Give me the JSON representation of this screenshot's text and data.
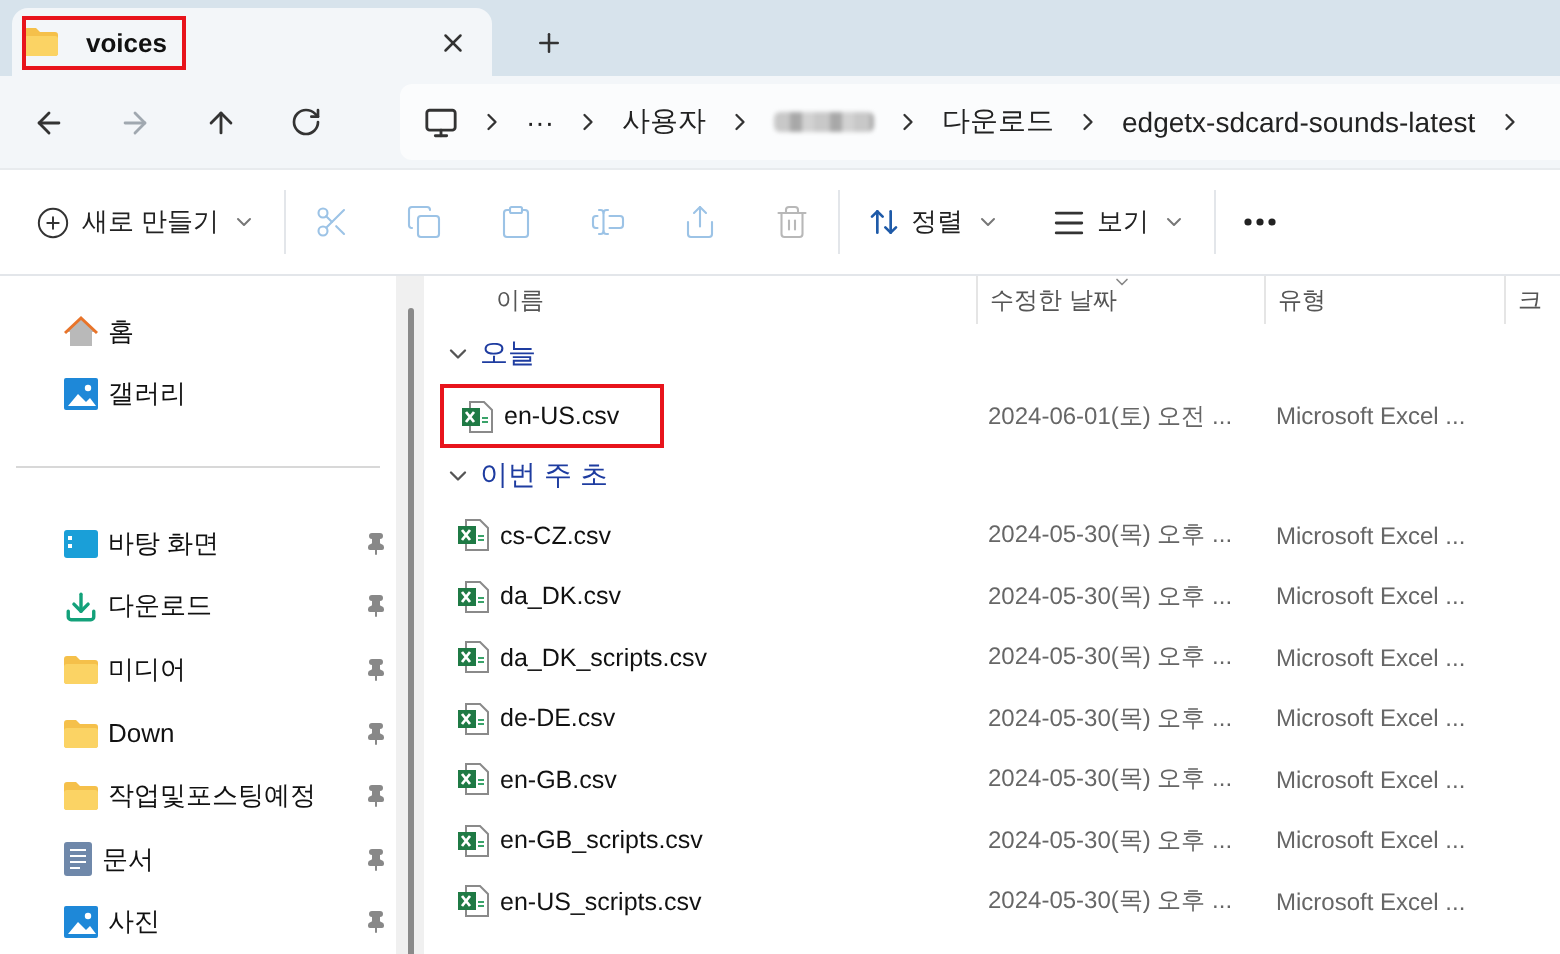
{
  "tabs": [
    {
      "title": "voices",
      "selected": true,
      "highlighted": true
    }
  ],
  "address": {
    "nav": [
      {
        "kind": "back",
        "disabled": false
      },
      {
        "kind": "forward",
        "disabled": true
      },
      {
        "kind": "up",
        "disabled": false
      },
      {
        "kind": "refresh",
        "disabled": false
      }
    ],
    "breadcrumb": [
      {
        "kind": "computer"
      },
      {
        "kind": "text",
        "label": "···"
      },
      {
        "kind": "text",
        "label": "사용자"
      },
      {
        "kind": "redacted"
      },
      {
        "kind": "text",
        "label": "다운로드"
      },
      {
        "kind": "text",
        "label": "edgetx-sdcard-sounds-latest"
      }
    ]
  },
  "toolbar": {
    "new_label": "새로 만들기",
    "actions": [
      {
        "kind": "cut",
        "disabled": true
      },
      {
        "kind": "copy",
        "disabled": true
      },
      {
        "kind": "paste",
        "disabled": true
      },
      {
        "kind": "rename",
        "disabled": true
      },
      {
        "kind": "share",
        "disabled": true
      },
      {
        "kind": "delete",
        "disabled": true
      }
    ],
    "sort_label": "정렬",
    "view_label": "보기"
  },
  "sidebar": {
    "groups": [
      [
        {
          "kind": "home",
          "label": "홈",
          "pinned": false
        },
        {
          "kind": "gallery",
          "label": "갤러리",
          "pinned": false
        }
      ],
      [
        {
          "kind": "desktop",
          "label": "바탕 화면",
          "pinned": true
        },
        {
          "kind": "download",
          "label": "다운로드",
          "pinned": true
        },
        {
          "kind": "folder",
          "label": "미디어",
          "pinned": true
        },
        {
          "kind": "folder",
          "label": "Down",
          "pinned": true
        },
        {
          "kind": "folder",
          "label": "작업및포스팅예정",
          "pinned": true
        },
        {
          "kind": "document",
          "label": "문서",
          "pinned": true
        },
        {
          "kind": "picture",
          "label": "사진",
          "pinned": true
        }
      ]
    ]
  },
  "table": {
    "columns": [
      {
        "label": "이름",
        "sorted": false
      },
      {
        "label": "수정한 날짜",
        "sorted": true
      },
      {
        "label": "유형",
        "sorted": false
      },
      {
        "label": "크",
        "sorted": false
      }
    ],
    "groups": [
      {
        "title": "오늘",
        "expanded": true,
        "files": [
          {
            "name": "en-US.csv",
            "modified": "2024-06-01(토) 오전 ...",
            "type": "Microsoft Excel ...",
            "highlighted": true
          }
        ]
      },
      {
        "title": "이번 주 초",
        "expanded": true,
        "files": [
          {
            "name": "cs-CZ.csv",
            "modified": "2024-05-30(목) 오후 ...",
            "type": "Microsoft Excel ...",
            "highlighted": false
          },
          {
            "name": "da_DK.csv",
            "modified": "2024-05-30(목) 오후 ...",
            "type": "Microsoft Excel ...",
            "highlighted": false
          },
          {
            "name": "da_DK_scripts.csv",
            "modified": "2024-05-30(목) 오후 ...",
            "type": "Microsoft Excel ...",
            "highlighted": false
          },
          {
            "name": "de-DE.csv",
            "modified": "2024-05-30(목) 오후 ...",
            "type": "Microsoft Excel ...",
            "highlighted": false
          },
          {
            "name": "en-GB.csv",
            "modified": "2024-05-30(목) 오후 ...",
            "type": "Microsoft Excel ...",
            "highlighted": false
          },
          {
            "name": "en-GB_scripts.csv",
            "modified": "2024-05-30(목) 오후 ...",
            "type": "Microsoft Excel ...",
            "highlighted": false
          },
          {
            "name": "en-US_scripts.csv",
            "modified": "2024-05-30(목) 오후 ...",
            "type": "Microsoft Excel ...",
            "highlighted": false
          }
        ]
      }
    ]
  }
}
